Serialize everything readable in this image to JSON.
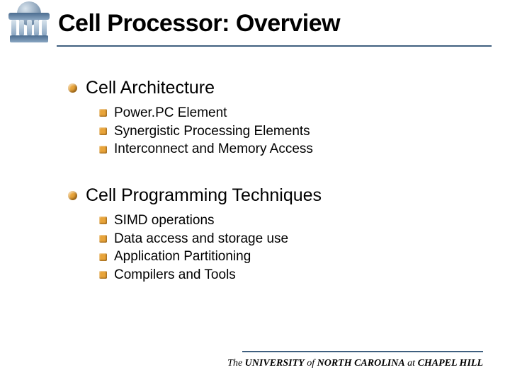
{
  "title": "Cell Processor: Overview",
  "sections": [
    {
      "heading": "Cell Architecture",
      "items": [
        "Power.PC Element",
        "Synergistic Processing Elements",
        "Interconnect and Memory Access"
      ]
    },
    {
      "heading": "Cell Programming Techniques",
      "items": [
        "SIMD operations",
        "Data access and storage use",
        "Application Partitioning",
        "Compilers and Tools"
      ]
    }
  ],
  "footer": {
    "the": "The",
    "uni": "UNIVERSITY",
    "of": "of",
    "nc": "NORTH  CAROLINA",
    "at": "at",
    "ch": "CHAPEL HILL"
  }
}
